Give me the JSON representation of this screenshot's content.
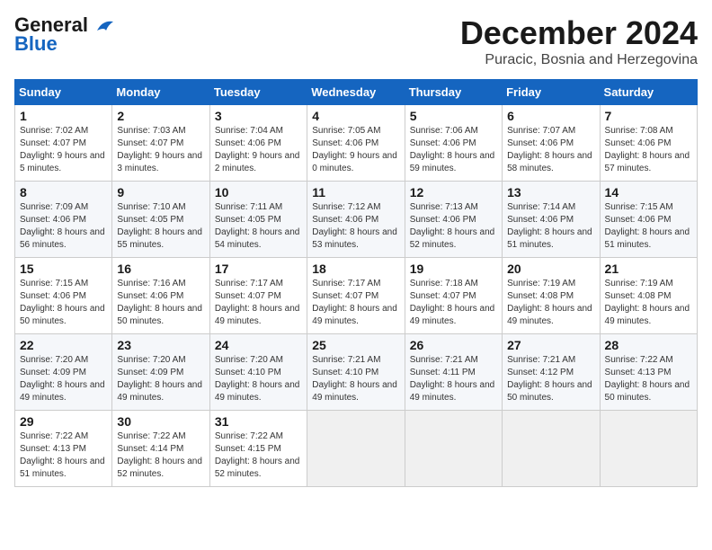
{
  "logo": {
    "line1": "General",
    "line2": "Blue"
  },
  "header": {
    "month": "December 2024",
    "location": "Puracic, Bosnia and Herzegovina"
  },
  "weekdays": [
    "Sunday",
    "Monday",
    "Tuesday",
    "Wednesday",
    "Thursday",
    "Friday",
    "Saturday"
  ],
  "weeks": [
    [
      {
        "day": 1,
        "sunrise": "7:02 AM",
        "sunset": "4:07 PM",
        "daylight": "9 hours and 5 minutes."
      },
      {
        "day": 2,
        "sunrise": "7:03 AM",
        "sunset": "4:07 PM",
        "daylight": "9 hours and 3 minutes."
      },
      {
        "day": 3,
        "sunrise": "7:04 AM",
        "sunset": "4:06 PM",
        "daylight": "9 hours and 2 minutes."
      },
      {
        "day": 4,
        "sunrise": "7:05 AM",
        "sunset": "4:06 PM",
        "daylight": "9 hours and 0 minutes."
      },
      {
        "day": 5,
        "sunrise": "7:06 AM",
        "sunset": "4:06 PM",
        "daylight": "8 hours and 59 minutes."
      },
      {
        "day": 6,
        "sunrise": "7:07 AM",
        "sunset": "4:06 PM",
        "daylight": "8 hours and 58 minutes."
      },
      {
        "day": 7,
        "sunrise": "7:08 AM",
        "sunset": "4:06 PM",
        "daylight": "8 hours and 57 minutes."
      }
    ],
    [
      {
        "day": 8,
        "sunrise": "7:09 AM",
        "sunset": "4:06 PM",
        "daylight": "8 hours and 56 minutes."
      },
      {
        "day": 9,
        "sunrise": "7:10 AM",
        "sunset": "4:05 PM",
        "daylight": "8 hours and 55 minutes."
      },
      {
        "day": 10,
        "sunrise": "7:11 AM",
        "sunset": "4:05 PM",
        "daylight": "8 hours and 54 minutes."
      },
      {
        "day": 11,
        "sunrise": "7:12 AM",
        "sunset": "4:06 PM",
        "daylight": "8 hours and 53 minutes."
      },
      {
        "day": 12,
        "sunrise": "7:13 AM",
        "sunset": "4:06 PM",
        "daylight": "8 hours and 52 minutes."
      },
      {
        "day": 13,
        "sunrise": "7:14 AM",
        "sunset": "4:06 PM",
        "daylight": "8 hours and 51 minutes."
      },
      {
        "day": 14,
        "sunrise": "7:15 AM",
        "sunset": "4:06 PM",
        "daylight": "8 hours and 51 minutes."
      }
    ],
    [
      {
        "day": 15,
        "sunrise": "7:15 AM",
        "sunset": "4:06 PM",
        "daylight": "8 hours and 50 minutes."
      },
      {
        "day": 16,
        "sunrise": "7:16 AM",
        "sunset": "4:06 PM",
        "daylight": "8 hours and 50 minutes."
      },
      {
        "day": 17,
        "sunrise": "7:17 AM",
        "sunset": "4:07 PM",
        "daylight": "8 hours and 49 minutes."
      },
      {
        "day": 18,
        "sunrise": "7:17 AM",
        "sunset": "4:07 PM",
        "daylight": "8 hours and 49 minutes."
      },
      {
        "day": 19,
        "sunrise": "7:18 AM",
        "sunset": "4:07 PM",
        "daylight": "8 hours and 49 minutes."
      },
      {
        "day": 20,
        "sunrise": "7:19 AM",
        "sunset": "4:08 PM",
        "daylight": "8 hours and 49 minutes."
      },
      {
        "day": 21,
        "sunrise": "7:19 AM",
        "sunset": "4:08 PM",
        "daylight": "8 hours and 49 minutes."
      }
    ],
    [
      {
        "day": 22,
        "sunrise": "7:20 AM",
        "sunset": "4:09 PM",
        "daylight": "8 hours and 49 minutes."
      },
      {
        "day": 23,
        "sunrise": "7:20 AM",
        "sunset": "4:09 PM",
        "daylight": "8 hours and 49 minutes."
      },
      {
        "day": 24,
        "sunrise": "7:20 AM",
        "sunset": "4:10 PM",
        "daylight": "8 hours and 49 minutes."
      },
      {
        "day": 25,
        "sunrise": "7:21 AM",
        "sunset": "4:10 PM",
        "daylight": "8 hours and 49 minutes."
      },
      {
        "day": 26,
        "sunrise": "7:21 AM",
        "sunset": "4:11 PM",
        "daylight": "8 hours and 49 minutes."
      },
      {
        "day": 27,
        "sunrise": "7:21 AM",
        "sunset": "4:12 PM",
        "daylight": "8 hours and 50 minutes."
      },
      {
        "day": 28,
        "sunrise": "7:22 AM",
        "sunset": "4:13 PM",
        "daylight": "8 hours and 50 minutes."
      }
    ],
    [
      {
        "day": 29,
        "sunrise": "7:22 AM",
        "sunset": "4:13 PM",
        "daylight": "8 hours and 51 minutes."
      },
      {
        "day": 30,
        "sunrise": "7:22 AM",
        "sunset": "4:14 PM",
        "daylight": "8 hours and 52 minutes."
      },
      {
        "day": 31,
        "sunrise": "7:22 AM",
        "sunset": "4:15 PM",
        "daylight": "8 hours and 52 minutes."
      },
      null,
      null,
      null,
      null
    ]
  ]
}
